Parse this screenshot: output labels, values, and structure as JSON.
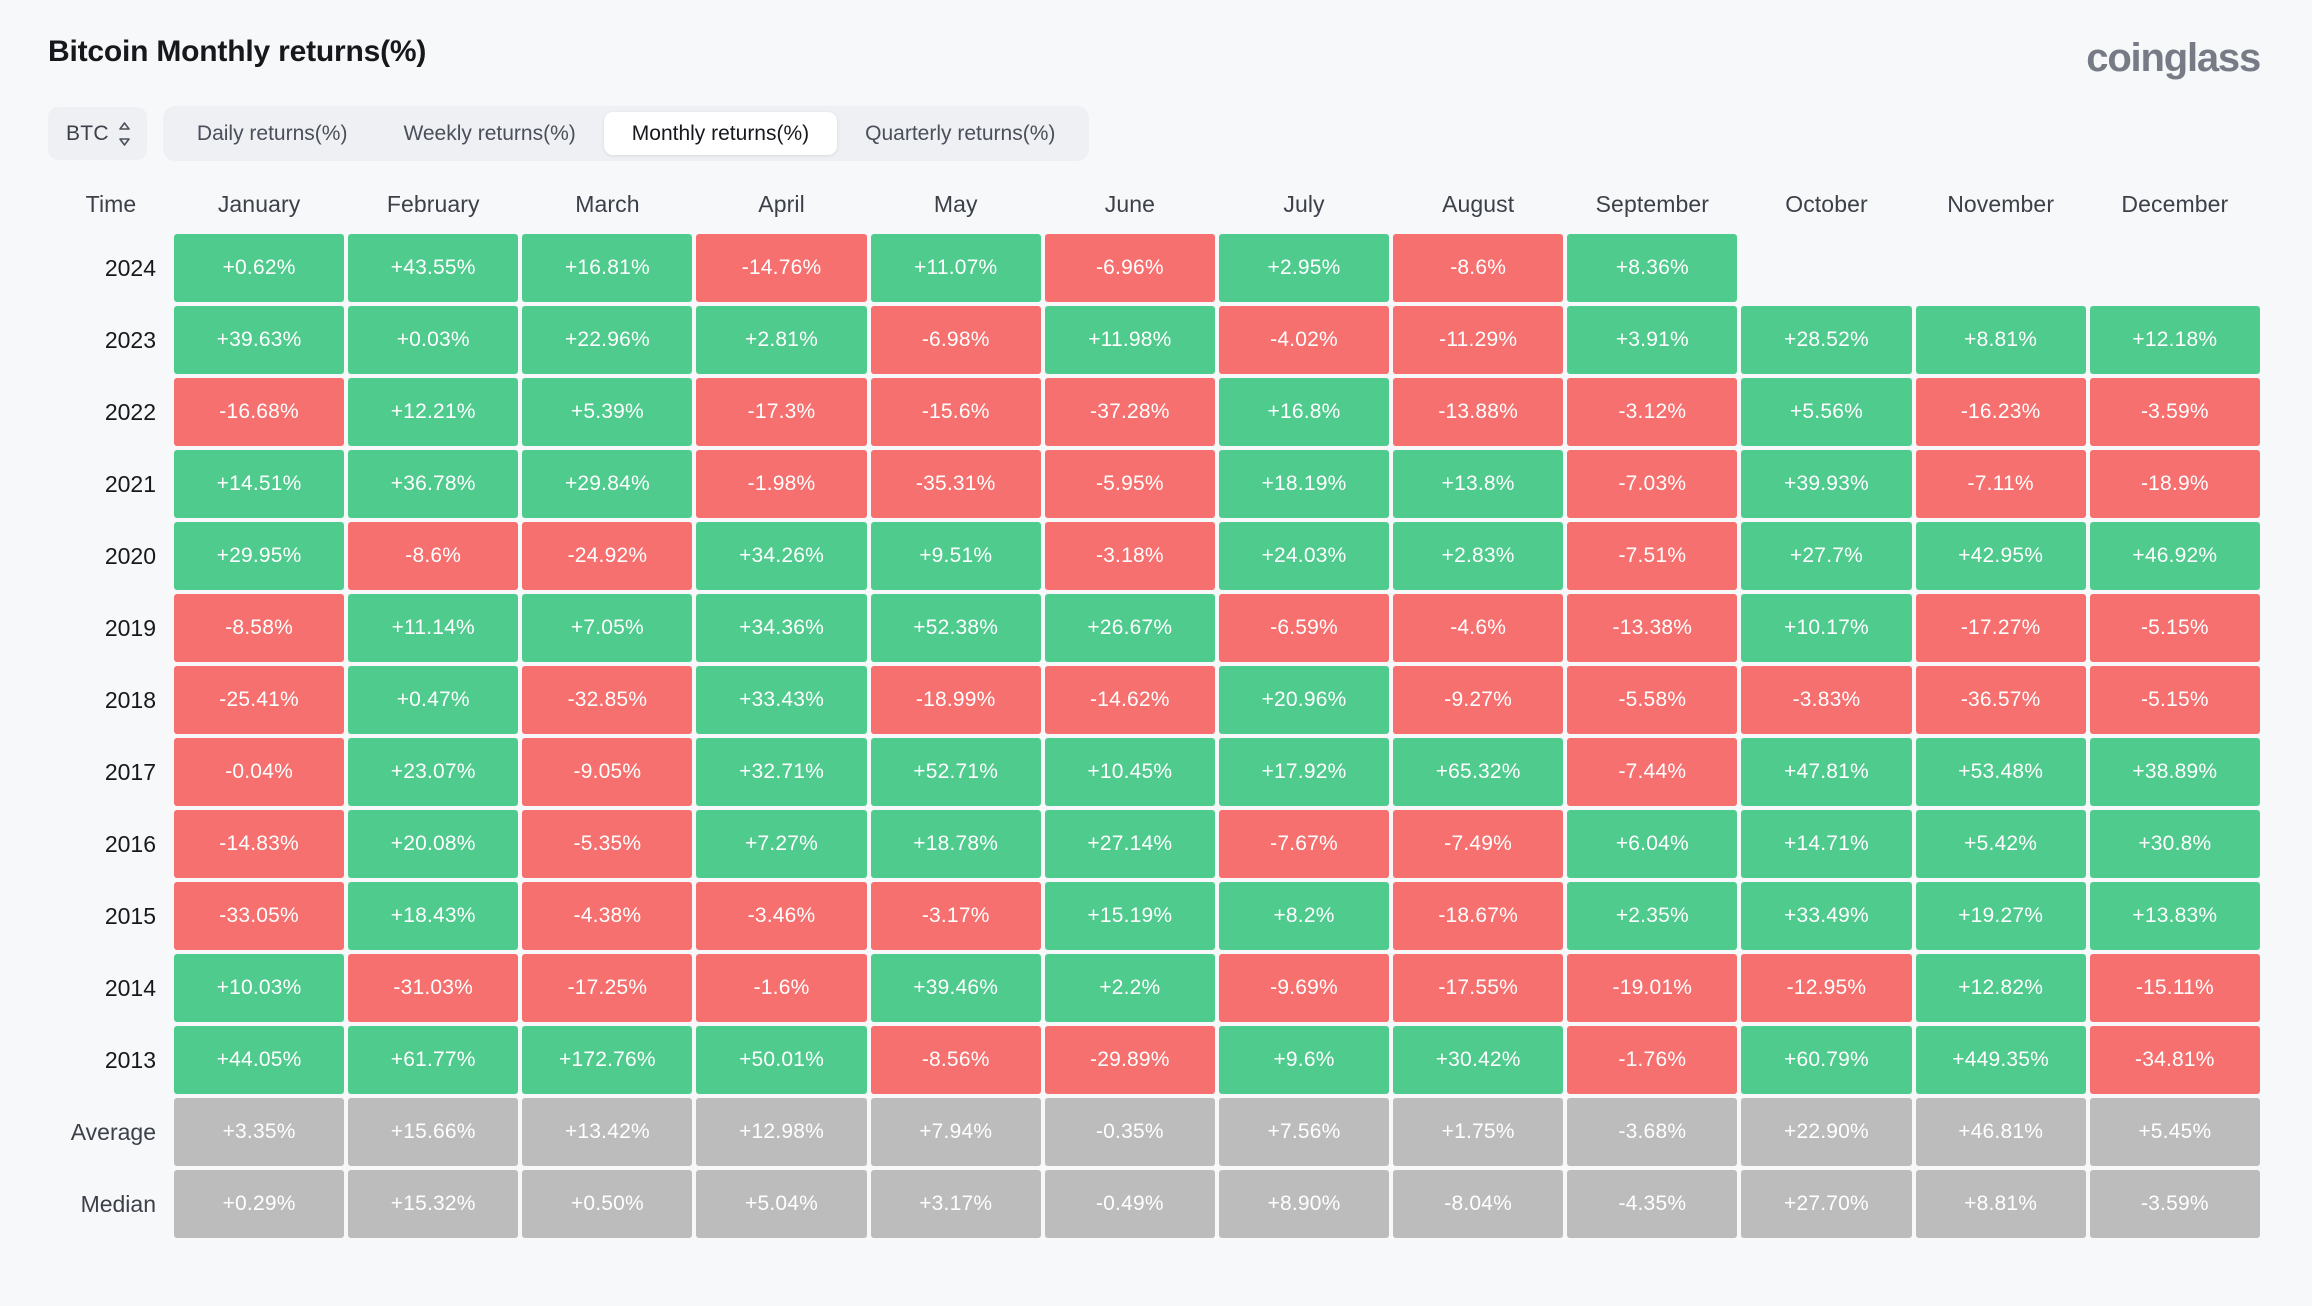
{
  "header": {
    "title": "Bitcoin Monthly returns(%)",
    "brand": "coinglass"
  },
  "controls": {
    "symbol": "BTC",
    "symbol_icon": "stepper-updown-icon",
    "tabs": [
      {
        "label": "Daily returns(%)",
        "active": false
      },
      {
        "label": "Weekly returns(%)",
        "active": false
      },
      {
        "label": "Monthly returns(%)",
        "active": true
      },
      {
        "label": "Quarterly returns(%)",
        "active": false
      }
    ]
  },
  "colors": {
    "positive": "#4ecb8d",
    "negative": "#f6706f",
    "stat": "#bcbcbc",
    "background": "#f7f8fa",
    "tab_bar": "#eef0f4",
    "brand": "#767b86"
  },
  "chart_data": {
    "type": "heatmap",
    "title": "Bitcoin Monthly returns(%)",
    "xlabel": "",
    "ylabel": "Time",
    "columns": [
      "Time",
      "January",
      "February",
      "March",
      "April",
      "May",
      "June",
      "July",
      "August",
      "September",
      "October",
      "November",
      "December"
    ],
    "rows": [
      {
        "label": "2024",
        "type": "year",
        "values": [
          "+0.62%",
          "+43.55%",
          "+16.81%",
          "-14.76%",
          "+11.07%",
          "-6.96%",
          "+2.95%",
          "-8.6%",
          "+8.36%",
          "",
          "",
          ""
        ]
      },
      {
        "label": "2023",
        "type": "year",
        "values": [
          "+39.63%",
          "+0.03%",
          "+22.96%",
          "+2.81%",
          "-6.98%",
          "+11.98%",
          "-4.02%",
          "-11.29%",
          "+3.91%",
          "+28.52%",
          "+8.81%",
          "+12.18%"
        ]
      },
      {
        "label": "2022",
        "type": "year",
        "values": [
          "-16.68%",
          "+12.21%",
          "+5.39%",
          "-17.3%",
          "-15.6%",
          "-37.28%",
          "+16.8%",
          "-13.88%",
          "-3.12%",
          "+5.56%",
          "-16.23%",
          "-3.59%"
        ]
      },
      {
        "label": "2021",
        "type": "year",
        "values": [
          "+14.51%",
          "+36.78%",
          "+29.84%",
          "-1.98%",
          "-35.31%",
          "-5.95%",
          "+18.19%",
          "+13.8%",
          "-7.03%",
          "+39.93%",
          "-7.11%",
          "-18.9%"
        ]
      },
      {
        "label": "2020",
        "type": "year",
        "values": [
          "+29.95%",
          "-8.6%",
          "-24.92%",
          "+34.26%",
          "+9.51%",
          "-3.18%",
          "+24.03%",
          "+2.83%",
          "-7.51%",
          "+27.7%",
          "+42.95%",
          "+46.92%"
        ]
      },
      {
        "label": "2019",
        "type": "year",
        "values": [
          "-8.58%",
          "+11.14%",
          "+7.05%",
          "+34.36%",
          "+52.38%",
          "+26.67%",
          "-6.59%",
          "-4.6%",
          "-13.38%",
          "+10.17%",
          "-17.27%",
          "-5.15%"
        ]
      },
      {
        "label": "2018",
        "type": "year",
        "values": [
          "-25.41%",
          "+0.47%",
          "-32.85%",
          "+33.43%",
          "-18.99%",
          "-14.62%",
          "+20.96%",
          "-9.27%",
          "-5.58%",
          "-3.83%",
          "-36.57%",
          "-5.15%"
        ]
      },
      {
        "label": "2017",
        "type": "year",
        "values": [
          "-0.04%",
          "+23.07%",
          "-9.05%",
          "+32.71%",
          "+52.71%",
          "+10.45%",
          "+17.92%",
          "+65.32%",
          "-7.44%",
          "+47.81%",
          "+53.48%",
          "+38.89%"
        ]
      },
      {
        "label": "2016",
        "type": "year",
        "values": [
          "-14.83%",
          "+20.08%",
          "-5.35%",
          "+7.27%",
          "+18.78%",
          "+27.14%",
          "-7.67%",
          "-7.49%",
          "+6.04%",
          "+14.71%",
          "+5.42%",
          "+30.8%"
        ]
      },
      {
        "label": "2015",
        "type": "year",
        "values": [
          "-33.05%",
          "+18.43%",
          "-4.38%",
          "-3.46%",
          "-3.17%",
          "+15.19%",
          "+8.2%",
          "-18.67%",
          "+2.35%",
          "+33.49%",
          "+19.27%",
          "+13.83%"
        ]
      },
      {
        "label": "2014",
        "type": "year",
        "values": [
          "+10.03%",
          "-31.03%",
          "-17.25%",
          "-1.6%",
          "+39.46%",
          "+2.2%",
          "-9.69%",
          "-17.55%",
          "-19.01%",
          "-12.95%",
          "+12.82%",
          "-15.11%"
        ]
      },
      {
        "label": "2013",
        "type": "year",
        "values": [
          "+44.05%",
          "+61.77%",
          "+172.76%",
          "+50.01%",
          "-8.56%",
          "-29.89%",
          "+9.6%",
          "+30.42%",
          "-1.76%",
          "+60.79%",
          "+449.35%",
          "-34.81%"
        ]
      },
      {
        "label": "Average",
        "type": "stat",
        "values": [
          "+3.35%",
          "+15.66%",
          "+13.42%",
          "+12.98%",
          "+7.94%",
          "-0.35%",
          "+7.56%",
          "+1.75%",
          "-3.68%",
          "+22.90%",
          "+46.81%",
          "+5.45%"
        ]
      },
      {
        "label": "Median",
        "type": "stat",
        "values": [
          "+0.29%",
          "+15.32%",
          "+0.50%",
          "+5.04%",
          "+3.17%",
          "-0.49%",
          "+8.90%",
          "-8.04%",
          "-4.35%",
          "+27.70%",
          "+8.81%",
          "-3.59%"
        ]
      }
    ]
  }
}
